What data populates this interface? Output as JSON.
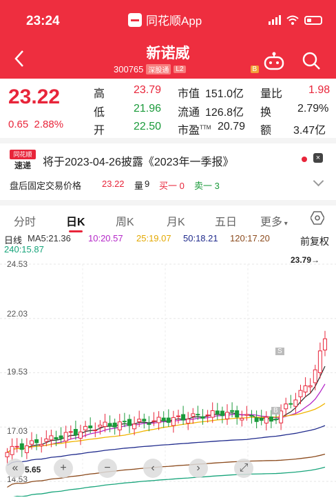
{
  "status_bar": {
    "time": "23:24",
    "app_name": "同花顺App"
  },
  "header": {
    "stock_name": "新诺威",
    "stock_code": "300765",
    "tag_sgt": "深股通",
    "tag_l2": "L2",
    "tag_b": "B"
  },
  "quote": {
    "price": "23.22",
    "change": "0.65",
    "change_pct": "2.88%",
    "stats": [
      {
        "label": "高",
        "value": "23.79",
        "color": "red"
      },
      {
        "label": "市值",
        "value": "151.0亿",
        "color": "black"
      },
      {
        "label": "量比",
        "value": "1.98",
        "color": "red"
      },
      {
        "label": "低",
        "value": "21.96",
        "color": "green"
      },
      {
        "label": "流通",
        "value": "126.8亿",
        "color": "black"
      },
      {
        "label": "换",
        "value": "2.79%",
        "color": "black"
      },
      {
        "label": "开",
        "value": "22.50",
        "color": "green"
      },
      {
        "label": "市盈",
        "value": "20.79",
        "sup": "TTM",
        "color": "black"
      },
      {
        "label": "额",
        "value": "3.47亿",
        "color": "black"
      }
    ]
  },
  "notice": {
    "logo_top": "同花顺",
    "logo_bottom": "速递",
    "text": "将于2023-04-26披露《2023年一季报》"
  },
  "after_hours": {
    "label": "盘后固定交易价格",
    "price": "23.22",
    "vol_label": "量",
    "vol": "9",
    "buy": "买一 0",
    "sell": "卖一 3"
  },
  "tabs": [
    "分时",
    "日K",
    "周K",
    "月K",
    "五日",
    "更多"
  ],
  "ma": {
    "label": "日线",
    "ma5": "MA5:21.36",
    "ma10": "10:20.57",
    "ma25": "25:19.07",
    "ma50": "50:18.21",
    "ma120": "120:17.20",
    "ma240": "240:15.87",
    "adjust": "前复权"
  },
  "chart_data": {
    "type": "candlestick",
    "y_ticks": [
      "24.53",
      "22.03",
      "19.53",
      "17.03",
      "14.53"
    ],
    "ylim": [
      14.53,
      24.53
    ],
    "high_label": "23.79→",
    "low_label": "5.65",
    "markers": [
      "S",
      "B"
    ],
    "colors": {
      "up": "#e8253a",
      "down": "#1a9a3a",
      "ma5": "#333333",
      "ma10": "#b427c8",
      "ma25": "#f0b400",
      "ma50": "#1f2a8c",
      "ma120": "#8b4a1c",
      "ma240": "#16a47a"
    }
  }
}
